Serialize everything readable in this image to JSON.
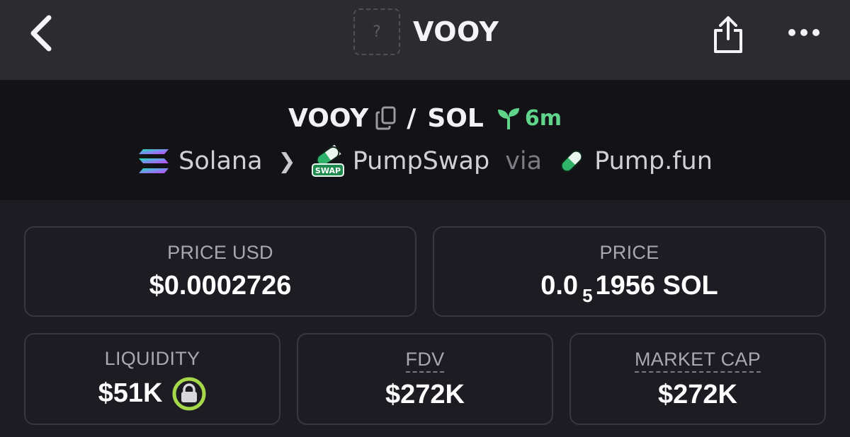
{
  "nav": {
    "title": "VOOY",
    "token_placeholder": "?",
    "icons": {
      "back": "back-chevron-icon",
      "share": "share-icon",
      "more": "more-dots-icon"
    }
  },
  "pair": {
    "base": "VOOY",
    "separator": "/",
    "quote": "SOL",
    "age": "6m",
    "icons": {
      "copy": "copy-icon",
      "age": "seedling-icon"
    }
  },
  "chain": {
    "chain_name": "Solana",
    "dex_name": "PumpSwap",
    "dex_badge": "SWAP",
    "via": "via",
    "launchpad": "Pump.fun"
  },
  "stats": {
    "price_usd": {
      "label": "PRICE USD",
      "value": "$0.0002726"
    },
    "price": {
      "label": "PRICE",
      "value_lead": "0.0",
      "value_zeros": "5",
      "value_tail": "1956 SOL"
    },
    "liquidity": {
      "label": "LIQUIDITY",
      "value": "$51K"
    },
    "fdv": {
      "label": "FDV",
      "value": "$272K"
    },
    "market_cap": {
      "label": "MARKET CAP",
      "value": "$272K"
    }
  },
  "colors": {
    "nav_bg": "#2b2b30",
    "band_bg": "#131317",
    "page_bg": "#1c1c22",
    "age_green": "#5fd48a",
    "lock_green": "#a6d84a"
  }
}
